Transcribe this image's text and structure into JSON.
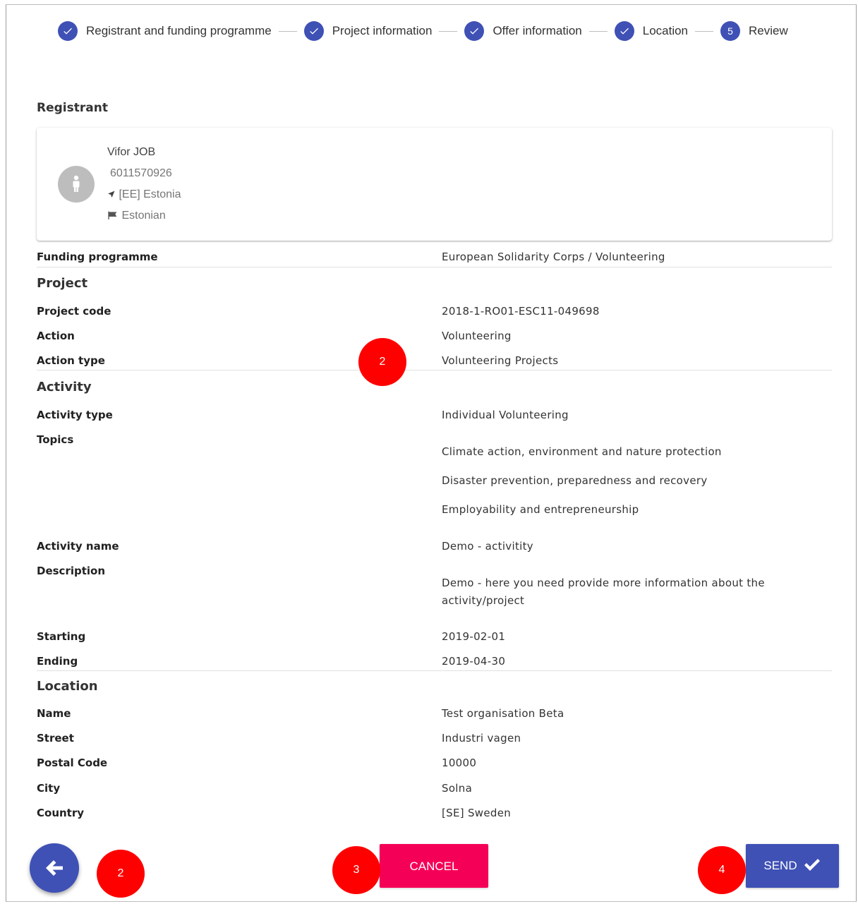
{
  "stepper": {
    "steps": [
      {
        "label": "Registrant and funding programme",
        "state": "done"
      },
      {
        "label": "Project information",
        "state": "done"
      },
      {
        "label": "Offer information",
        "state": "done"
      },
      {
        "label": "Location",
        "state": "done"
      },
      {
        "label": "Review",
        "state": "active",
        "number": "5"
      }
    ]
  },
  "registrant": {
    "heading": "Registrant",
    "name": "Vifor JOB",
    "id": "6011570926",
    "country": "[EE] Estonia",
    "language": "Estonian"
  },
  "funding": {
    "label": "Funding programme",
    "value": "European Solidarity Corps / Volunteering"
  },
  "project": {
    "heading": "Project",
    "code_label": "Project code",
    "code": "2018-1-RO01-ESC11-049698",
    "action_label": "Action",
    "action": "Volunteering",
    "action_type_label": "Action type",
    "action_type": "Volunteering Projects"
  },
  "activity": {
    "heading": "Activity",
    "type_label": "Activity type",
    "type": "Individual Volunteering",
    "topics_label": "Topics",
    "topics": [
      "Climate action, environment and nature protection",
      "Disaster prevention, preparedness and recovery",
      "Employability and entrepreneurship"
    ],
    "name_label": "Activity name",
    "name": "Demo - activitity",
    "description_label": "Description",
    "description_line1": "Demo - here you need provide more information about the",
    "description_line2": "activity/project",
    "starting_label": "Starting",
    "starting": "2019-02-01",
    "ending_label": "Ending",
    "ending": "2019-04-30"
  },
  "location": {
    "heading": "Location",
    "name_label": "Name",
    "name": "Test organisation Beta",
    "street_label": "Street",
    "street": "Industri vagen",
    "postal_label": "Postal Code",
    "postal": "10000",
    "city_label": "City",
    "city": "Solna",
    "country_label": "Country",
    "country": "[SE] Sweden"
  },
  "actions": {
    "back_icon": "arrow-left-icon",
    "cancel_label": "CANCEL",
    "send_label": "SEND",
    "send_icon": "check-icon"
  },
  "markers": {
    "m1": "2",
    "m2": "2",
    "m3": "3",
    "m4": "4"
  },
  "colors": {
    "primary": "#3f51b5",
    "accent": "#f50057",
    "marker": "#ff0000"
  }
}
